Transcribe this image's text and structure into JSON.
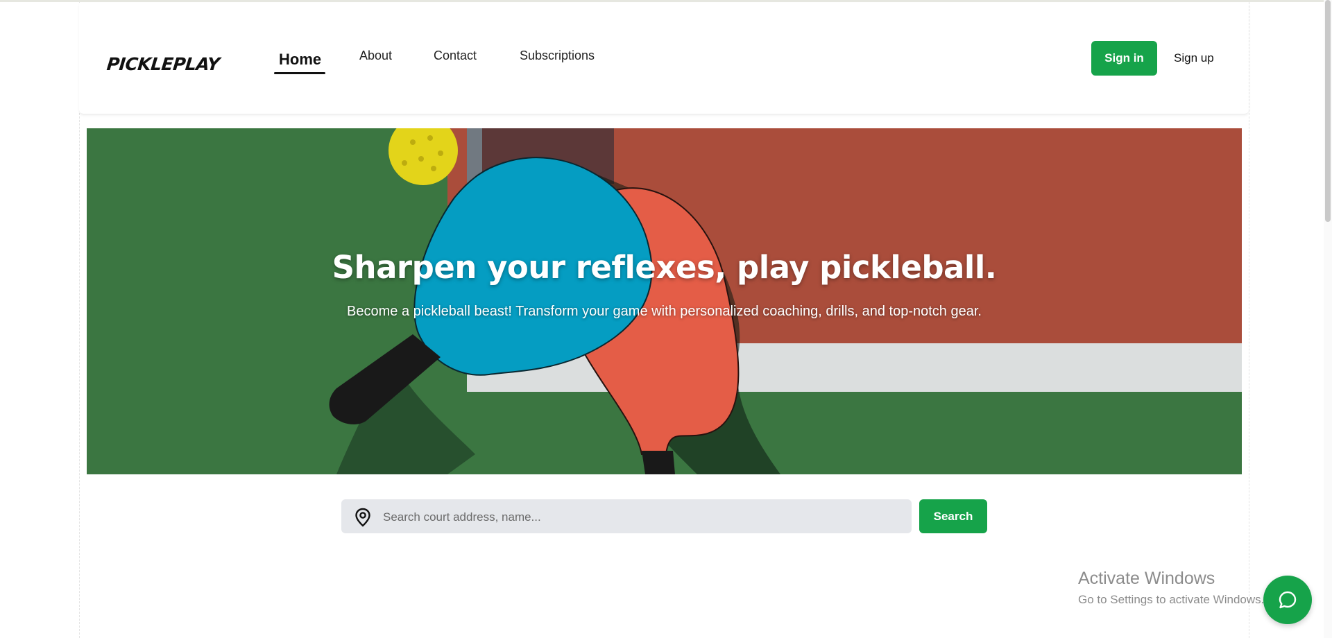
{
  "brand": {
    "name": "PICKLEPLAY"
  },
  "nav": {
    "items": [
      {
        "label": "Home",
        "active": true
      },
      {
        "label": "About",
        "active": false
      },
      {
        "label": "Contact",
        "active": false
      },
      {
        "label": "Subscriptions",
        "active": false
      }
    ]
  },
  "auth": {
    "signin_label": "Sign in",
    "signup_label": "Sign up"
  },
  "hero": {
    "title": "Sharpen your reflexes, play pickleball.",
    "subtitle": "Become a pickleball beast! Transform your game with personalized coaching, drills, and top-notch gear."
  },
  "search": {
    "placeholder": "Search court address, name...",
    "value": "",
    "button_label": "Search",
    "icon": "location-pin-icon"
  },
  "watermark": {
    "line1": "Activate Windows",
    "line2": "Go to Settings to activate Windows."
  },
  "chat": {
    "icon": "chat-bubble-icon"
  },
  "colors": {
    "accent": "#16a34a",
    "court_green": "#3f7e46",
    "court_red": "#b5523f",
    "paddle_blue": "#06a7cf",
    "paddle_red": "#f3634c",
    "ball_yellow": "#f2e21c",
    "search_bg": "#e5e7eb"
  }
}
